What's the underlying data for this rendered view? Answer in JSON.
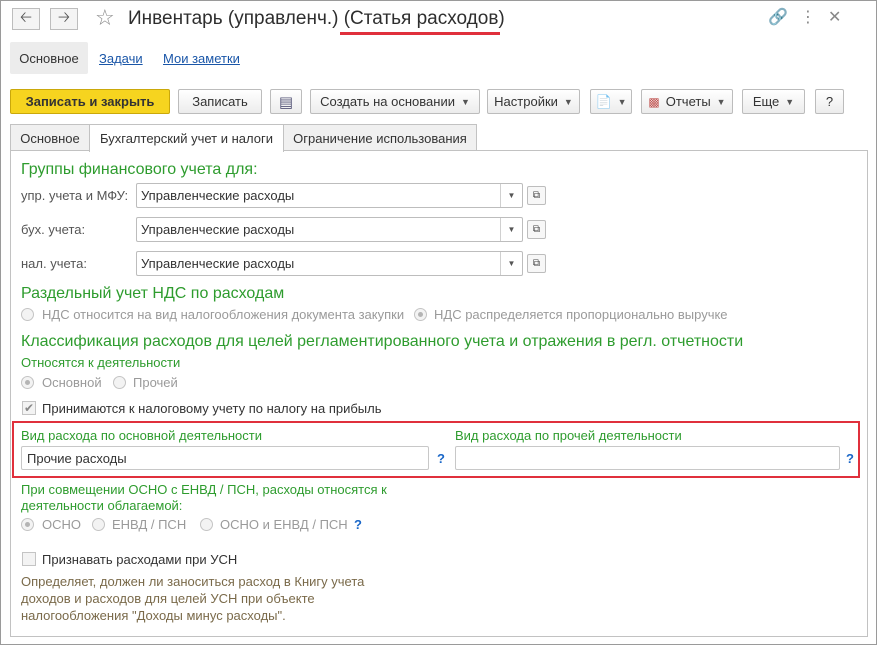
{
  "window": {
    "title": "Инвентарь (управленч.) ",
    "title_highlight": "(Статья расходов)",
    "back_icon": "arrow-left-icon",
    "forward_icon": "arrow-right-icon",
    "star_icon": "star-icon",
    "link_icon": "link-icon",
    "menu_icon": "kebab-menu-icon",
    "close_icon": "close-icon"
  },
  "sections": {
    "main": "Основное",
    "tasks": "Задачи",
    "notes": "Мои заметки"
  },
  "toolbar": {
    "save_close": "Записать и закрыть",
    "save": "Записать",
    "create_based": "Создать на основании",
    "settings": "Настройки",
    "reports": "Отчеты",
    "more": "Еще",
    "help": "?"
  },
  "tabs": [
    "Основное",
    "Бухгалтерский учет и налоги",
    "Ограничение использования"
  ],
  "fin_groups": {
    "heading": "Группы финансового учета для:",
    "rows": [
      {
        "label": "упр. учета и МФУ:",
        "value": "Управленческие расходы"
      },
      {
        "label": "бух. учета:",
        "value": "Управленческие расходы"
      },
      {
        "label": "нал. учета:",
        "value": "Управленческие расходы"
      }
    ]
  },
  "vat": {
    "heading": "Раздельный учет НДС по расходам",
    "option1": "НДС относится на вид налогообложения документа закупки",
    "option2": "НДС распределяется пропорционально выручке",
    "selected": 2
  },
  "classification": {
    "heading": "Классификация расходов для целей регламентированного учета и отражения в регл. отчетности",
    "activity_label": "Относятся к деятельности",
    "opt_main": "Основной",
    "opt_other": "Прочей",
    "selected": "Основной",
    "tax_check_label": "Принимаются к налоговому учету по налогу на прибыль",
    "tax_checked": true
  },
  "expense_types": {
    "main_label": "Вид расхода по основной деятельности",
    "main_value": "Прочие расходы",
    "other_label": "Вид расхода по прочей деятельности",
    "other_value": "",
    "help": "?"
  },
  "osno": {
    "label_line1": "При совмещении ОСНО с ЕНВД / ПСН, расходы относятся к",
    "label_line2": "деятельности облагаемой:",
    "opt1": "ОСНО",
    "opt2": "ЕНВД / ПСН",
    "opt3": "ОСНО и ЕНВД / ПСН",
    "selected": "ОСНО",
    "help": "?"
  },
  "usn": {
    "check_label": "Признавать расходами при УСН",
    "checked": false,
    "hint_lines": [
      "Определяет, должен ли заноситься расход в Книгу учета",
      "доходов и расходов для целей УСН при объекте",
      "налогообложения \"Доходы минус расходы\"."
    ]
  },
  "colors": {
    "accent_yellow": "#f6d41f",
    "heading_green": "#2e9c2e",
    "highlight_red": "#e0303c",
    "link_blue": "#1a56a8"
  }
}
